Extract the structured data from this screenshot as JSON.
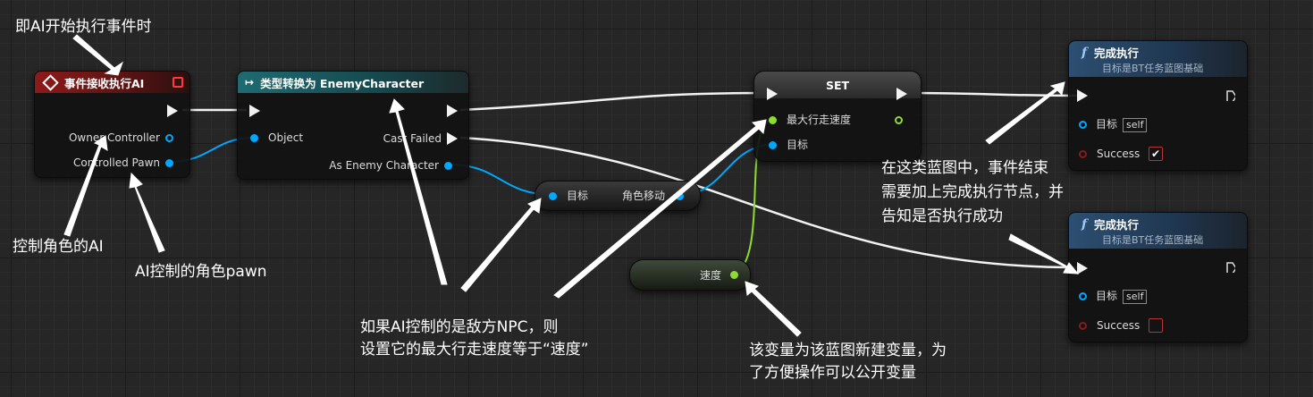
{
  "nodes": {
    "event": {
      "title": "事件接收执行AI",
      "owner_controller": "Owner Controller",
      "controlled_pawn": "Controlled Pawn"
    },
    "cast": {
      "title": "类型转换为 EnemyCharacter",
      "object": "Object",
      "cast_failed": "Cast Failed",
      "as_enemy": "As Enemy Character"
    },
    "get_move": {
      "target": "目标",
      "label": "角色移动"
    },
    "set": {
      "title": "SET",
      "max_speed": "最大行走速度",
      "target": "目标"
    },
    "speed_var": {
      "label": "速度"
    },
    "finish1": {
      "title": "完成执行",
      "subtitle": "目标是BT任务蓝图基础",
      "target": "目标",
      "self": "self",
      "success": "Success",
      "success_checked": true
    },
    "finish2": {
      "title": "完成执行",
      "subtitle": "目标是BT任务蓝图基础",
      "target": "目标",
      "self": "self",
      "success": "Success",
      "success_checked": false
    }
  },
  "annotations": {
    "top": "即AI开始执行事件时",
    "pawn_ctrl": "控制角色的AI",
    "pawn": "AI控制的角色pawn",
    "npc_line1": "如果AI控制的是敌方NPC，则",
    "npc_line2": "设置它的最大行走速度等于“速度”",
    "finish_line1": "在这类蓝图中，事件结束",
    "finish_line2": "需要加上完成执行节点，并",
    "finish_line3": "告知是否执行成功",
    "var_line1": "该变量为该蓝图新建变量，为",
    "var_line2": "了方便操作可以公开变量"
  },
  "colors": {
    "exec": "#f2f2f2",
    "object_pin": "#00a8ff",
    "float_pin": "#8fdc30",
    "event_header": "#8e1a1a",
    "cast_header": "#1f6b72",
    "func_header": "#2d4f72",
    "bool_pin": "#8a1a1a"
  }
}
